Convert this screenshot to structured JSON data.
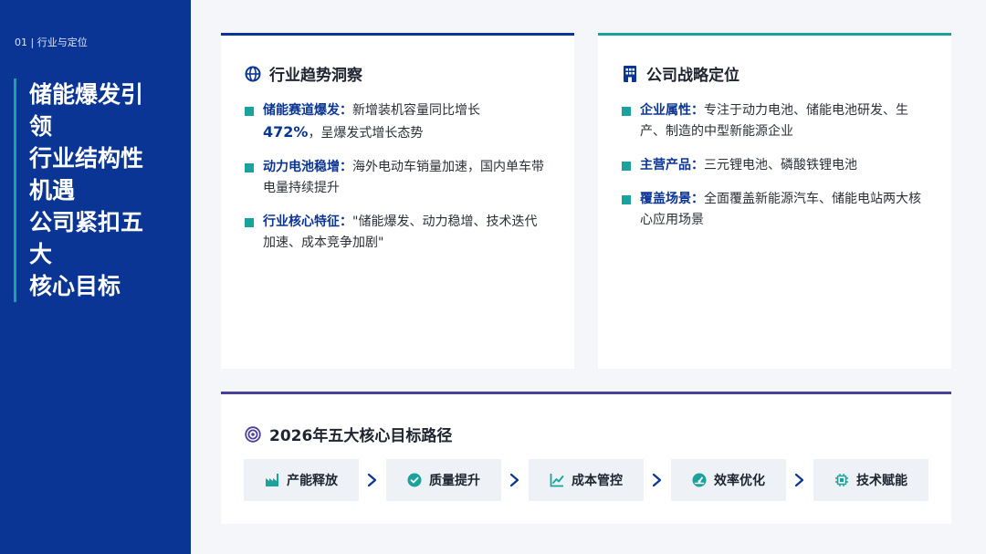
{
  "sidebar": {
    "section_tag": "01 | 行业与定位",
    "title_lines": [
      "储能爆发引",
      "领",
      "行业结构性",
      "机遇",
      "公司紧扣五",
      "大",
      "核心目标"
    ]
  },
  "colors": {
    "primary": "#0a3594",
    "accent": "#1aa39c",
    "purple": "#4a3f9a"
  },
  "industry": {
    "title": "行业趋势洞察",
    "icon": "globe-icon",
    "items": [
      {
        "label": "储能赛道爆发：",
        "text_before": "新增装机容量同比增长",
        "highlight": "472%",
        "text_after": "，呈爆发式增长态势"
      },
      {
        "label": "动力电池稳增：",
        "text": "海外电动车销量加速，国内单车带电量持续提升"
      },
      {
        "label": "行业核心特征：",
        "text": "\"储能爆发、动力稳增、技术迭代加速、成本竞争加剧\""
      }
    ]
  },
  "company": {
    "title": "公司战略定位",
    "icon": "building-icon",
    "items": [
      {
        "label": "企业属性：",
        "text": "专注于动力电池、储能电池研发、生产、制造的中型新能源企业"
      },
      {
        "label": "主营产品：",
        "text": "三元锂电池、磷酸铁锂电池"
      },
      {
        "label": "覆盖场景：",
        "text": "全面覆盖新能源汽车、储能电站两大核心应用场景"
      }
    ]
  },
  "goals": {
    "title": "2026年五大核心目标路径",
    "icon": "target-icon",
    "steps": [
      {
        "label": "产能释放",
        "icon": "factory-icon"
      },
      {
        "label": "质量提升",
        "icon": "check-circle-icon"
      },
      {
        "label": "成本管控",
        "icon": "chart-line-icon"
      },
      {
        "label": "效率优化",
        "icon": "gauge-icon"
      },
      {
        "label": "技术赋能",
        "icon": "chip-icon"
      }
    ]
  }
}
